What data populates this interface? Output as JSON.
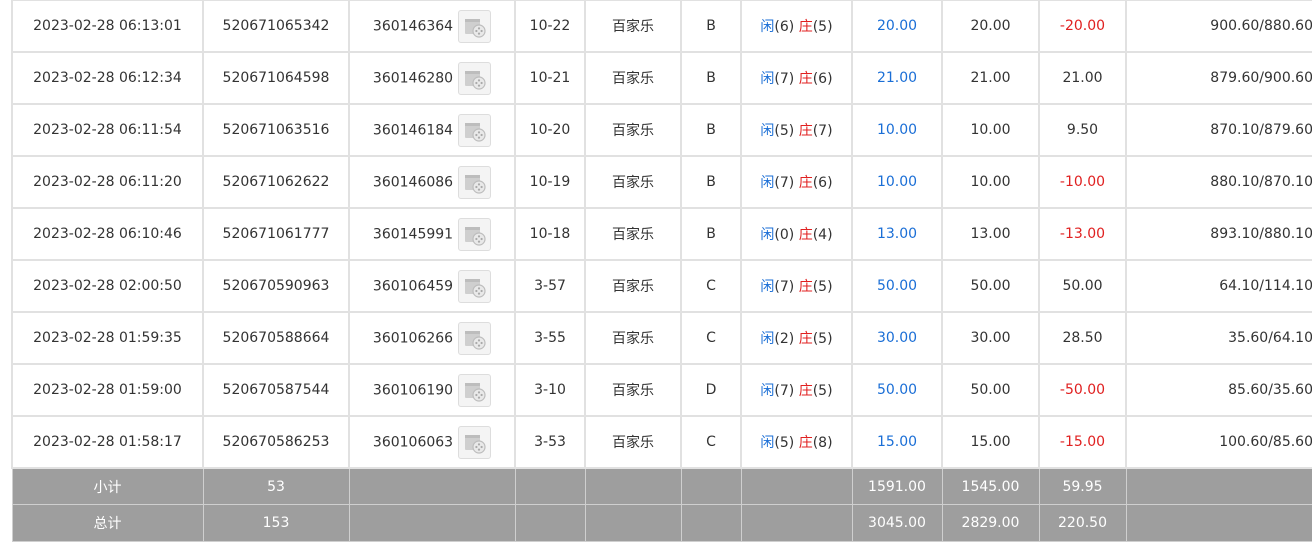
{
  "rows": [
    {
      "time": "2023-02-28 06:13:01",
      "order": "520671065342",
      "game": "360146364",
      "round": "10-22",
      "type": "百家乐",
      "table": "B",
      "p_label": "闲",
      "p_val": "(6)",
      "b_label": "庄",
      "b_val": "(5)",
      "bet": "20.00",
      "valid": "20.00",
      "win": "-20.00",
      "win_neg": true,
      "balance": "900.60/880.60"
    },
    {
      "time": "2023-02-28 06:12:34",
      "order": "520671064598",
      "game": "360146280",
      "round": "10-21",
      "type": "百家乐",
      "table": "B",
      "p_label": "闲",
      "p_val": "(7)",
      "b_label": "庄",
      "b_val": "(6)",
      "bet": "21.00",
      "valid": "21.00",
      "win": "21.00",
      "win_neg": false,
      "balance": "879.60/900.60"
    },
    {
      "time": "2023-02-28 06:11:54",
      "order": "520671063516",
      "game": "360146184",
      "round": "10-20",
      "type": "百家乐",
      "table": "B",
      "p_label": "闲",
      "p_val": "(5)",
      "b_label": "庄",
      "b_val": "(7)",
      "bet": "10.00",
      "valid": "10.00",
      "win": "9.50",
      "win_neg": false,
      "balance": "870.10/879.60"
    },
    {
      "time": "2023-02-28 06:11:20",
      "order": "520671062622",
      "game": "360146086",
      "round": "10-19",
      "type": "百家乐",
      "table": "B",
      "p_label": "闲",
      "p_val": "(7)",
      "b_label": "庄",
      "b_val": "(6)",
      "bet": "10.00",
      "valid": "10.00",
      "win": "-10.00",
      "win_neg": true,
      "balance": "880.10/870.10"
    },
    {
      "time": "2023-02-28 06:10:46",
      "order": "520671061777",
      "game": "360145991",
      "round": "10-18",
      "type": "百家乐",
      "table": "B",
      "p_label": "闲",
      "p_val": "(0)",
      "b_label": "庄",
      "b_val": "(4)",
      "bet": "13.00",
      "valid": "13.00",
      "win": "-13.00",
      "win_neg": true,
      "balance": "893.10/880.10"
    },
    {
      "time": "2023-02-28 02:00:50",
      "order": "520670590963",
      "game": "360106459",
      "round": "3-57",
      "type": "百家乐",
      "table": "C",
      "p_label": "闲",
      "p_val": "(7)",
      "b_label": "庄",
      "b_val": "(5)",
      "bet": "50.00",
      "valid": "50.00",
      "win": "50.00",
      "win_neg": false,
      "balance": "64.10/114.10"
    },
    {
      "time": "2023-02-28 01:59:35",
      "order": "520670588664",
      "game": "360106266",
      "round": "3-55",
      "type": "百家乐",
      "table": "C",
      "p_label": "闲",
      "p_val": "(2)",
      "b_label": "庄",
      "b_val": "(5)",
      "bet": "30.00",
      "valid": "30.00",
      "win": "28.50",
      "win_neg": false,
      "balance": "35.60/64.10"
    },
    {
      "time": "2023-02-28 01:59:00",
      "order": "520670587544",
      "game": "360106190",
      "round": "3-10",
      "type": "百家乐",
      "table": "D",
      "p_label": "闲",
      "p_val": "(7)",
      "b_label": "庄",
      "b_val": "(5)",
      "bet": "50.00",
      "valid": "50.00",
      "win": "-50.00",
      "win_neg": true,
      "balance": "85.60/35.60"
    },
    {
      "time": "2023-02-28 01:58:17",
      "order": "520670586253",
      "game": "360106063",
      "round": "3-53",
      "type": "百家乐",
      "table": "C",
      "p_label": "闲",
      "p_val": "(5)",
      "b_label": "庄",
      "b_val": "(8)",
      "bet": "15.00",
      "valid": "15.00",
      "win": "-15.00",
      "win_neg": true,
      "balance": "100.60/85.60"
    }
  ],
  "subtotal": {
    "label": "小计",
    "count": "53",
    "bet": "1591.00",
    "valid": "1545.00",
    "win": "59.95"
  },
  "total": {
    "label": "总计",
    "count": "153",
    "bet": "3045.00",
    "valid": "2829.00",
    "win": "220.50"
  },
  "colors": {
    "player": "#1a6ed6",
    "banker": "#e02020",
    "negative": "#e02020",
    "summary_bg": "#9e9e9e"
  },
  "icons": {
    "video": "video-replay-icon"
  }
}
